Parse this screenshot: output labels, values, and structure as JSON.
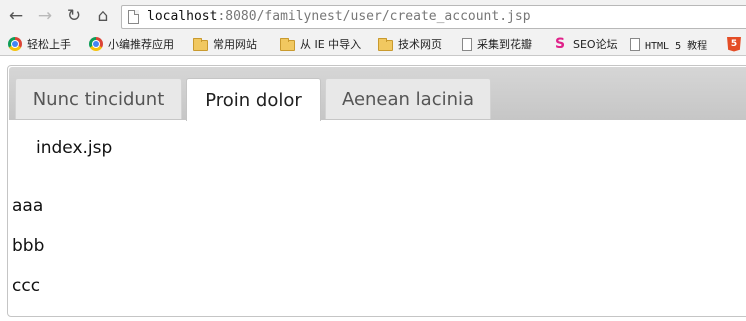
{
  "browser": {
    "url_host": "localhost",
    "url_rest": ":8080/familynest/user/create_account.jsp"
  },
  "bookmarks": [
    {
      "label": "轻松上手",
      "icon": "chrome-icon"
    },
    {
      "label": "小编推荐应用",
      "icon": "chrome-icon"
    },
    {
      "label": "常用网站",
      "icon": "folder-icon"
    },
    {
      "label": "从 IE 中导入",
      "icon": "folder-icon"
    },
    {
      "label": "技术网页",
      "icon": "folder-icon"
    },
    {
      "label": "采集到花瓣",
      "icon": "page-icon"
    },
    {
      "label": "SEO论坛",
      "icon": "seo-icon"
    },
    {
      "label": "HTML 5 教程",
      "icon": "page-icon"
    },
    {
      "label": "",
      "icon": "html5-icon"
    }
  ],
  "tabs": [
    {
      "label": "Nunc tincidunt"
    },
    {
      "label": "Proin dolor"
    },
    {
      "label": "Aenean lacinia"
    }
  ],
  "active_tab": "Proin dolor",
  "panel": {
    "text": "index.jsp"
  },
  "lines": [
    "aaa",
    "bbb",
    "ccc"
  ]
}
